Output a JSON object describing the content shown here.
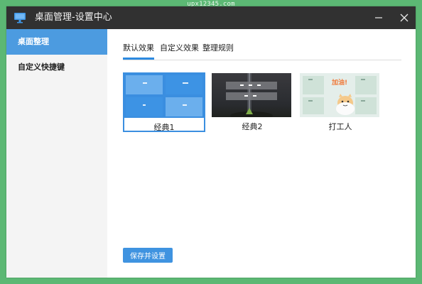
{
  "watermark": "upx12345.com",
  "window": {
    "title": "桌面管理-设置中心",
    "minimize_icon": "minimize-icon",
    "close_icon": "close-icon"
  },
  "sidebar": {
    "items": [
      {
        "label": "桌面整理",
        "active": true
      },
      {
        "label": "自定义快捷键",
        "active": false
      }
    ]
  },
  "main": {
    "tabs": [
      {
        "label": "默认效果",
        "active": true
      },
      {
        "label": "自定义效果",
        "active": false
      },
      {
        "label": "整理规则",
        "active": false
      }
    ],
    "themes": [
      {
        "label": "经典1",
        "selected": true
      },
      {
        "label": "经典2",
        "selected": false
      },
      {
        "label": "打工人",
        "selected": false,
        "sticker_text": "加油!"
      }
    ],
    "save_button": "保存并设置"
  },
  "colors": {
    "titlebar": "#313131",
    "accent": "#4c9be0",
    "save_button": "#3f93e0",
    "page_background": "#5cb874"
  }
}
